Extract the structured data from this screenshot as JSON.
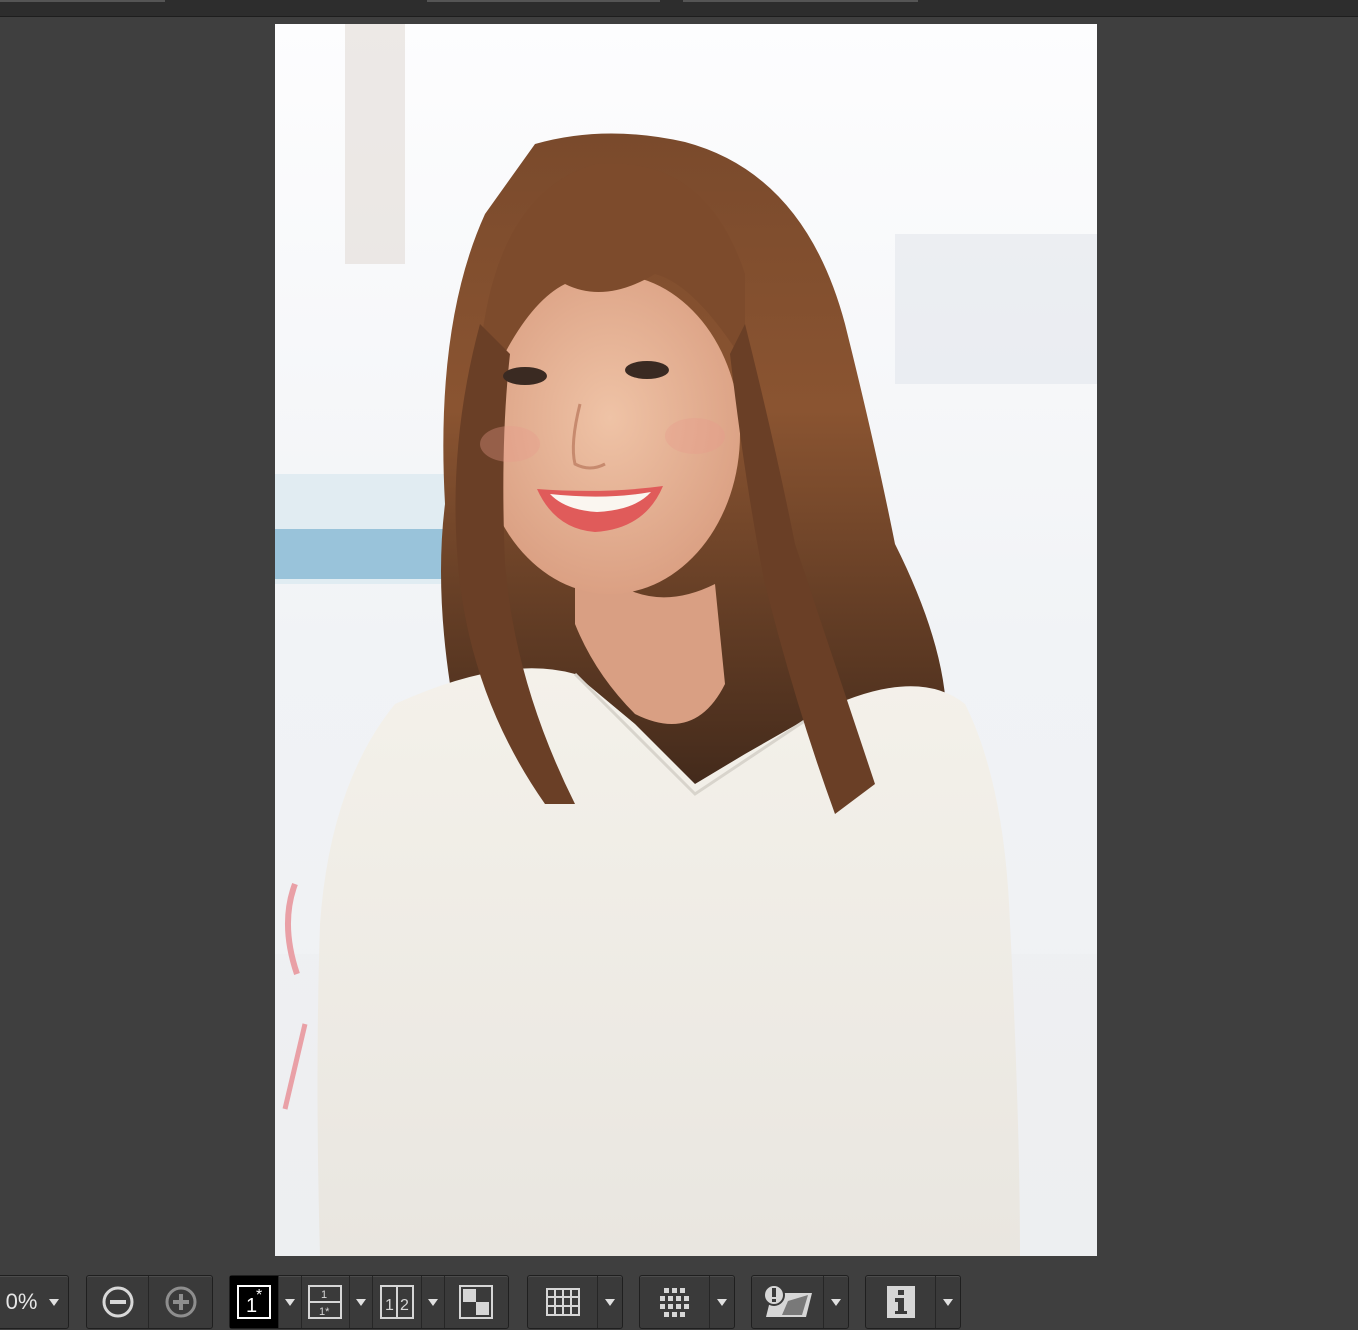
{
  "app": {
    "zoom_value": "0%"
  },
  "photo": {
    "subject": "portrait"
  },
  "toolbar": {
    "buttons": [
      {
        "name": "zoom-out-icon"
      },
      {
        "name": "zoom-in-icon"
      },
      {
        "name": "single-view-icon"
      },
      {
        "name": "split-vertical-icon"
      },
      {
        "name": "split-horizontal-icon"
      },
      {
        "name": "compare-layout-icon"
      },
      {
        "name": "grid-icon"
      },
      {
        "name": "thumbnail-grid-icon"
      },
      {
        "name": "warning-highlight-icon"
      },
      {
        "name": "info-icon"
      }
    ]
  },
  "colors": {
    "background": "#3f3f3f",
    "toolbar_group": "#3a3a3a",
    "selected_button": "#000000",
    "icon": "#d6d6d6"
  }
}
